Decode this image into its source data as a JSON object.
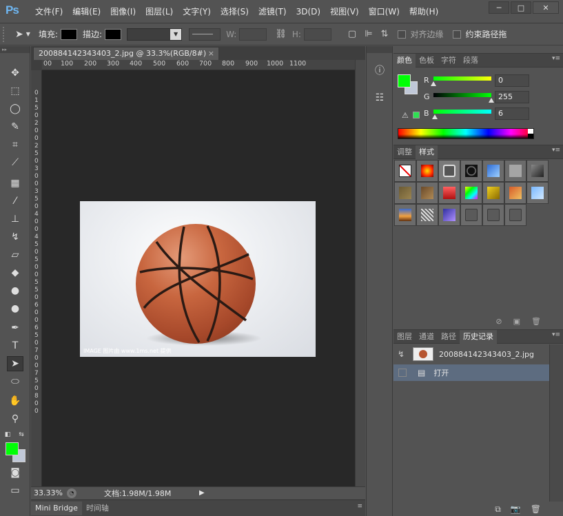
{
  "app": {
    "logo": "Ps"
  },
  "menu": [
    "文件(F)",
    "编辑(E)",
    "图像(I)",
    "图层(L)",
    "文字(Y)",
    "选择(S)",
    "滤镜(T)",
    "3D(D)",
    "视图(V)",
    "窗口(W)",
    "帮助(H)"
  ],
  "window_buttons": {
    "minimize": "─",
    "maximize": "□",
    "close": "✕"
  },
  "options": {
    "fill_label": "填充:",
    "stroke_label": "描边:",
    "w_label": "W:",
    "h_label": "H:",
    "align_edges": "对齐边缘",
    "constrain_path": "约束路径拖"
  },
  "document": {
    "tab_title": "200884142343403_2.jpg @ 33.3%(RGB/8#)",
    "close": "×",
    "ruler_ticks": [
      "00",
      "100",
      "200",
      "300",
      "400",
      "500",
      "600",
      "700",
      "800",
      "900",
      "1000",
      "1100"
    ],
    "ruler_left_ticks": [
      "0",
      "1",
      "5",
      "0",
      "2",
      "0",
      "0",
      "2",
      "5",
      "0",
      "3",
      "0",
      "0",
      "3",
      "5",
      "0",
      "4",
      "0",
      "0",
      "4",
      "5",
      "0",
      "5",
      "0",
      "0",
      "5",
      "5",
      "0",
      "6",
      "0",
      "0",
      "6",
      "5",
      "0",
      "7",
      "0",
      "0",
      "7",
      "5",
      "0",
      "8",
      "0",
      "0"
    ],
    "watermark": "IMAGE 图片由 www.1ms.net 提供",
    "zoom": "33.33%",
    "info": "文档:1.98M/1.98M"
  },
  "bottom_tabs": [
    "Mini Bridge",
    "时间轴"
  ],
  "color_panel": {
    "tabs": [
      "颜色",
      "色板",
      "字符",
      "段落"
    ],
    "r_label": "R",
    "g_label": "G",
    "b_label": "B",
    "r": "0",
    "g": "255",
    "b": "6",
    "r_pos": 0,
    "g_pos": 1.0,
    "b_pos": 0.02,
    "fg": "#00ff06",
    "bg": "#c0c8d8"
  },
  "styles_panel": {
    "tabs": [
      "调整",
      "样式"
    ],
    "styles": [
      {
        "name": "no-style",
        "bg": "#ffffff"
      },
      {
        "name": "red-glow",
        "bg": "radial-gradient(circle,#ffe000,#ff2a00 60%,#7a0000)"
      },
      {
        "name": "bevel-frame",
        "bg": "#555",
        "selected": true
      },
      {
        "name": "black-circle",
        "bg": "radial-gradient(circle,#111 40%,#888 45%,#111 60%)"
      },
      {
        "name": "blue-glass",
        "bg": "linear-gradient(135deg,#2d6cd6,#9ed0ff)"
      },
      {
        "name": "gray-flat",
        "bg": "#a5a5a5"
      },
      {
        "name": "dark-chrome",
        "bg": "linear-gradient(135deg,#888,#222)"
      },
      {
        "name": "bronze",
        "bg": "linear-gradient(135deg,#6b5a33,#9a8450)"
      },
      {
        "name": "copper",
        "bg": "linear-gradient(135deg,#6a4a2a,#b08a55)"
      },
      {
        "name": "red-button",
        "bg": "linear-gradient(#ff6060,#b01010)"
      },
      {
        "name": "rainbow-dots",
        "bg": "linear-gradient(135deg,#ff0,#0f0,#0ff,#f0f)"
      },
      {
        "name": "gold",
        "bg": "linear-gradient(135deg,#f0d020,#8a6a00)"
      },
      {
        "name": "sunset",
        "bg": "linear-gradient(135deg,#d65c2a,#f0c060)"
      },
      {
        "name": "sky-blue",
        "bg": "linear-gradient(135deg,#7ab8ff,#d0e8ff)"
      },
      {
        "name": "horizon",
        "bg": "linear-gradient(#3a6ad0,#f0a040 60%,#603010)"
      },
      {
        "name": "noise",
        "bg": "repeating-linear-gradient(45deg,#ddd 0 2px,#666 2px 4px)"
      },
      {
        "name": "purple-glass",
        "bg": "linear-gradient(135deg,#3030a0,#b090ff)"
      },
      {
        "name": "empty-1",
        "bg": "#5a5a5a"
      },
      {
        "name": "empty-2",
        "bg": "#5a5a5a"
      },
      {
        "name": "empty-3",
        "bg": "#5a5a5a"
      }
    ],
    "footer_icons": [
      "⊘",
      "▣",
      "🗑"
    ]
  },
  "history_panel": {
    "tabs": [
      "图层",
      "通道",
      "路径",
      "历史记录"
    ],
    "snapshot": "200884142343403_2.jpg",
    "step": "打开",
    "footer_icons": [
      "⧉",
      "📷",
      "🗑"
    ]
  },
  "colors": {
    "fg": "#00ff06",
    "bg": "#c0c8d8",
    "selected_row": "#5d6c80"
  }
}
